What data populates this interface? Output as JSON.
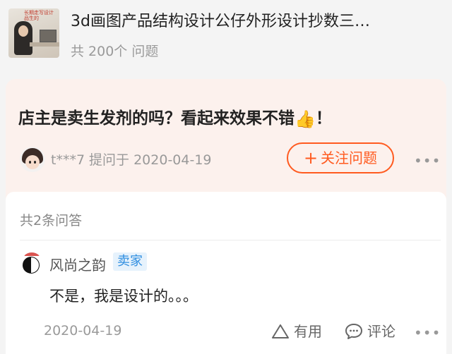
{
  "header": {
    "title": "3d画图产品结构设计公仔外形设计抄数三…",
    "question_count": "共 200个 问题",
    "thumbnail_caption": "长期走写设计品生的"
  },
  "question": {
    "text": "店主是卖生发剂的吗？看起来效果不错",
    "emoji": "👍",
    "end_punct": "！",
    "user": "t***7",
    "asked_at": "提问于 2020-04-19",
    "follow_label": "关注问题",
    "more": "•••"
  },
  "answers": {
    "count_label": "共2条问答",
    "items": [
      {
        "name": "风尚之韵",
        "badge": "卖家",
        "text": "不是，我是设计的。。。",
        "date": "2020-04-19",
        "useful_label": "有用",
        "comment_label": "评论",
        "more": "•••"
      }
    ]
  },
  "colors": {
    "accent": "#ff5a1f",
    "badge_text": "#2f8ee0",
    "badge_bg": "#e6f2fc",
    "question_bg": "#fcf1ed"
  }
}
